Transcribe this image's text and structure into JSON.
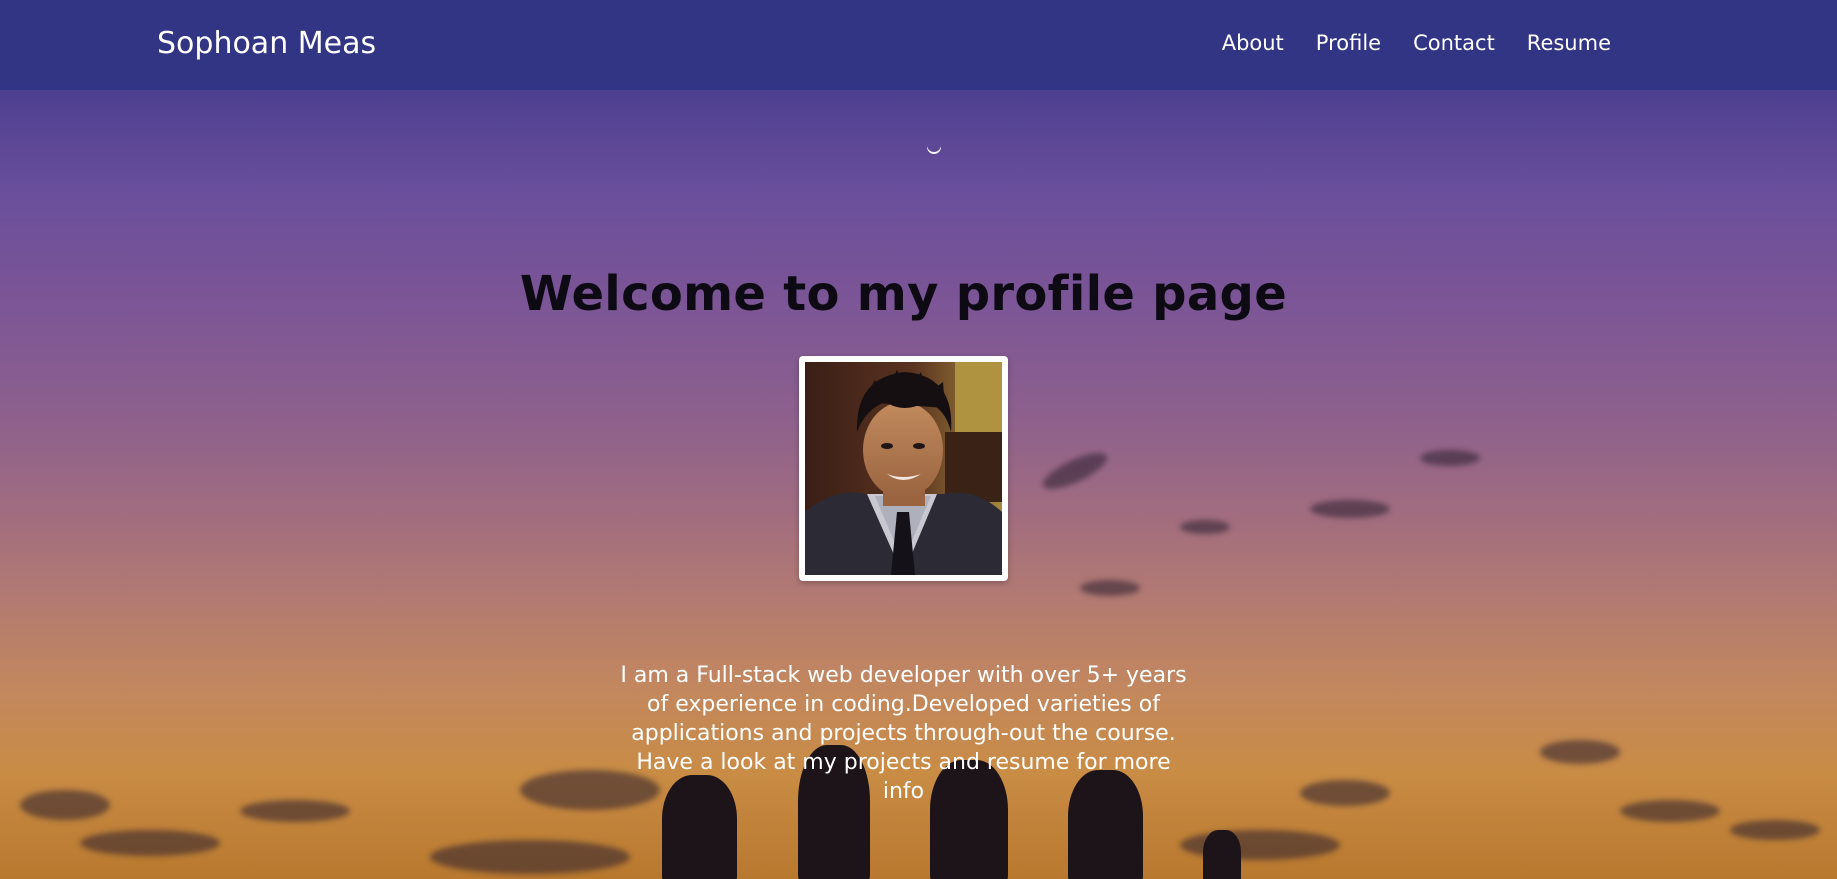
{
  "navbar": {
    "brand": "Sophoan Meas",
    "links": [
      {
        "label": "About"
      },
      {
        "label": "Profile"
      },
      {
        "label": "Contact"
      },
      {
        "label": "Resume"
      }
    ]
  },
  "hero": {
    "title": "Welcome to my profile page",
    "bio": "I am a Full-stack web developer with over 5+ years of experience in coding.Developed varieties of applications and projects through-out the course. Have a look at my projects and resume for more info"
  },
  "colors": {
    "navbar_bg": "#323484",
    "title_text": "#0d0a14",
    "link_text": "#ffffff"
  },
  "icons": {
    "moon": "crescent-moon-icon"
  }
}
